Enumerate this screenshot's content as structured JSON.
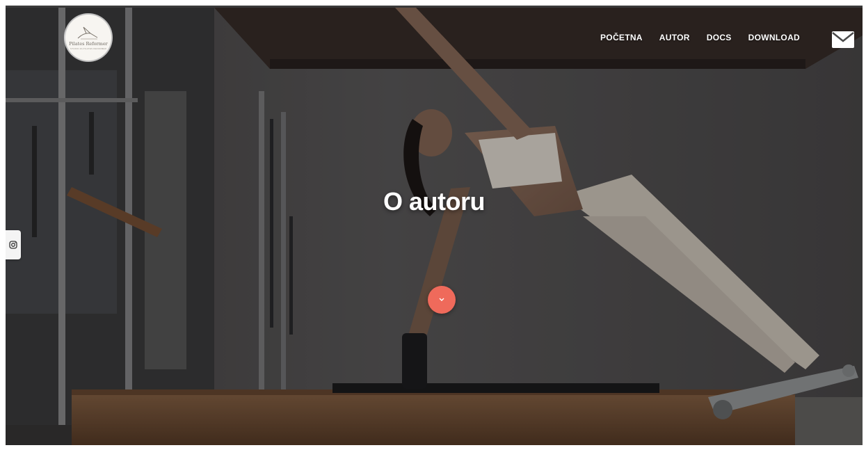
{
  "brand": {
    "name": "Pilates Reformer",
    "tagline": "STUDIO ZA PILATES REFORMER"
  },
  "nav": {
    "items": [
      "POČETNA",
      "AUTOR",
      "DOCS",
      "DOWNLOAD"
    ]
  },
  "hero": {
    "title": "O autoru"
  },
  "icons": {
    "contact": "mail-icon",
    "social": "instagram-icon",
    "scroll": "chevron-down-icon"
  },
  "colors": {
    "accent": "#ef6a5b",
    "nav_text": "#ffffff"
  }
}
